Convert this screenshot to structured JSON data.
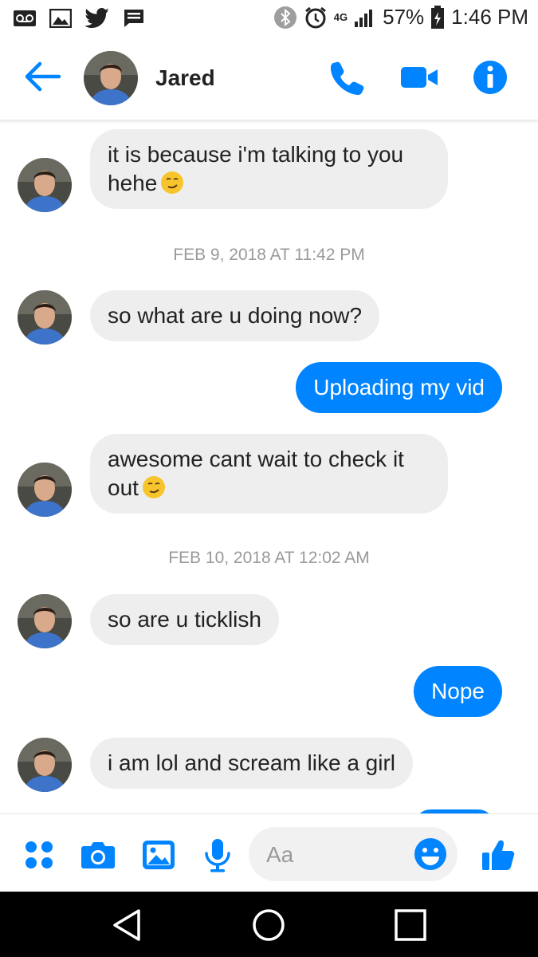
{
  "status_bar": {
    "battery": "57%",
    "time": "1:46 PM",
    "network": "4G"
  },
  "header": {
    "contact_name": "Jared"
  },
  "messages": [
    {
      "dir": "in",
      "text": "it is because i'm talking to you hehe",
      "emoji": "smirk-emoji"
    },
    {
      "type": "timestamp",
      "text": "FEB 9, 2018 AT 11:42 PM"
    },
    {
      "dir": "in",
      "text": "so what are u doing now?"
    },
    {
      "dir": "out",
      "text": "Uploading my vid"
    },
    {
      "dir": "in",
      "text": "awesome cant wait to check it out",
      "emoji": "smirk-emoji"
    },
    {
      "type": "timestamp",
      "text": "FEB 10, 2018 AT 12:02 AM"
    },
    {
      "dir": "in",
      "text": "so are u ticklish"
    },
    {
      "dir": "out",
      "text": "Nope"
    },
    {
      "dir": "in",
      "text": "i am lol and scream like a girl"
    }
  ],
  "composer": {
    "placeholder": "Aa"
  },
  "colors": {
    "accent": "#0084ff",
    "incoming_bubble": "#eeeeee",
    "timestamp": "#9a9a9a"
  }
}
